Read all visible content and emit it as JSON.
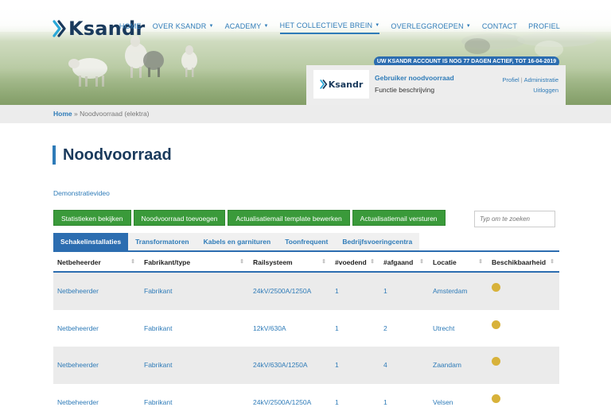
{
  "brand": {
    "name": "Ksandr"
  },
  "nav": {
    "items": [
      {
        "label": "HOME",
        "dropdown": false,
        "active": false
      },
      {
        "label": "OVER KSANDR",
        "dropdown": true,
        "active": false
      },
      {
        "label": "ACADEMY",
        "dropdown": true,
        "active": false
      },
      {
        "label": "HET COLLECTIEVE BREIN",
        "dropdown": true,
        "active": true
      },
      {
        "label": "OVERLEGGROEPEN",
        "dropdown": true,
        "active": false
      },
      {
        "label": "CONTACT",
        "dropdown": false,
        "active": false
      },
      {
        "label": "PROFIEL",
        "dropdown": false,
        "active": false
      }
    ]
  },
  "account": {
    "banner": "UW KSANDR ACCOUNT IS NOG 77 DAGEN ACTIEF, TOT 16-04-2019",
    "user_name": "Gebruiker noodvoorraad",
    "function": "Functie beschrijving",
    "link_profile": "Profiel",
    "link_separator": "|",
    "link_admin": "Administratie",
    "link_logout": "Uitloggen"
  },
  "breadcrumb": {
    "home": "Home",
    "separator": "»",
    "current": "Noodvoorraad (elektra)"
  },
  "page": {
    "title": "Noodvoorraad",
    "demo_link": "Demonstratievideo",
    "buttons": [
      "Statistieken bekijken",
      "Noodvoorraad toevoegen",
      "Actualisatiemail template bewerken",
      "Actualisatiemail versturen"
    ],
    "search_placeholder": "Typ om te zoeken"
  },
  "tabs": [
    {
      "label": "Schakelinstallaties",
      "active": true
    },
    {
      "label": "Transformatoren",
      "active": false
    },
    {
      "label": "Kabels en garnituren",
      "active": false
    },
    {
      "label": "Toonfrequent",
      "active": false
    },
    {
      "label": "Bedrijfsvoeringcentra",
      "active": false
    }
  ],
  "table": {
    "columns": [
      "Netbeheerder",
      "Fabrikant/type",
      "Railsysteem",
      "#voedend",
      "#afgaand",
      "Locatie",
      "Beschikbaarheid"
    ],
    "sortable": [
      true,
      true,
      true,
      true,
      true,
      true,
      true
    ],
    "rows": [
      {
        "netbeheerder": "Netbeheerder",
        "fabrikant": "Fabrikant",
        "railsysteem": "24kV/2500A/1250A",
        "voedend": "1",
        "afgaand": "1",
        "locatie": "Amsterdam",
        "status": "beschikbaar"
      },
      {
        "netbeheerder": "Netbeheerder",
        "fabrikant": "Fabrikant",
        "railsysteem": "12kV/630A",
        "voedend": "1",
        "afgaand": "2",
        "locatie": "Utrecht",
        "status": "beschikbaar"
      },
      {
        "netbeheerder": "Netbeheerder",
        "fabrikant": "Fabrikant",
        "railsysteem": "24kV/630A/1250A",
        "voedend": "1",
        "afgaand": "4",
        "locatie": "Zaandam",
        "status": "beschikbaar"
      },
      {
        "netbeheerder": "Netbeheerder",
        "fabrikant": "Fabrikant",
        "railsysteem": "24kV/2500A/1250A",
        "voedend": "1",
        "afgaand": "1",
        "locatie": "Velsen",
        "status": "beschikbaar"
      }
    ]
  },
  "colors": {
    "brand_dark": "#1a3a5c",
    "link_blue": "#2e7bb8",
    "accent_blue": "#2c6db0",
    "button_green": "#3a9a3a",
    "status_dot": "#d8b23a"
  },
  "icons": {
    "logo_mark": "ksandr-k-icon",
    "sort": "sort-arrows-icon",
    "dropdown": "caret-down-icon",
    "status": "status-dot-icon"
  }
}
